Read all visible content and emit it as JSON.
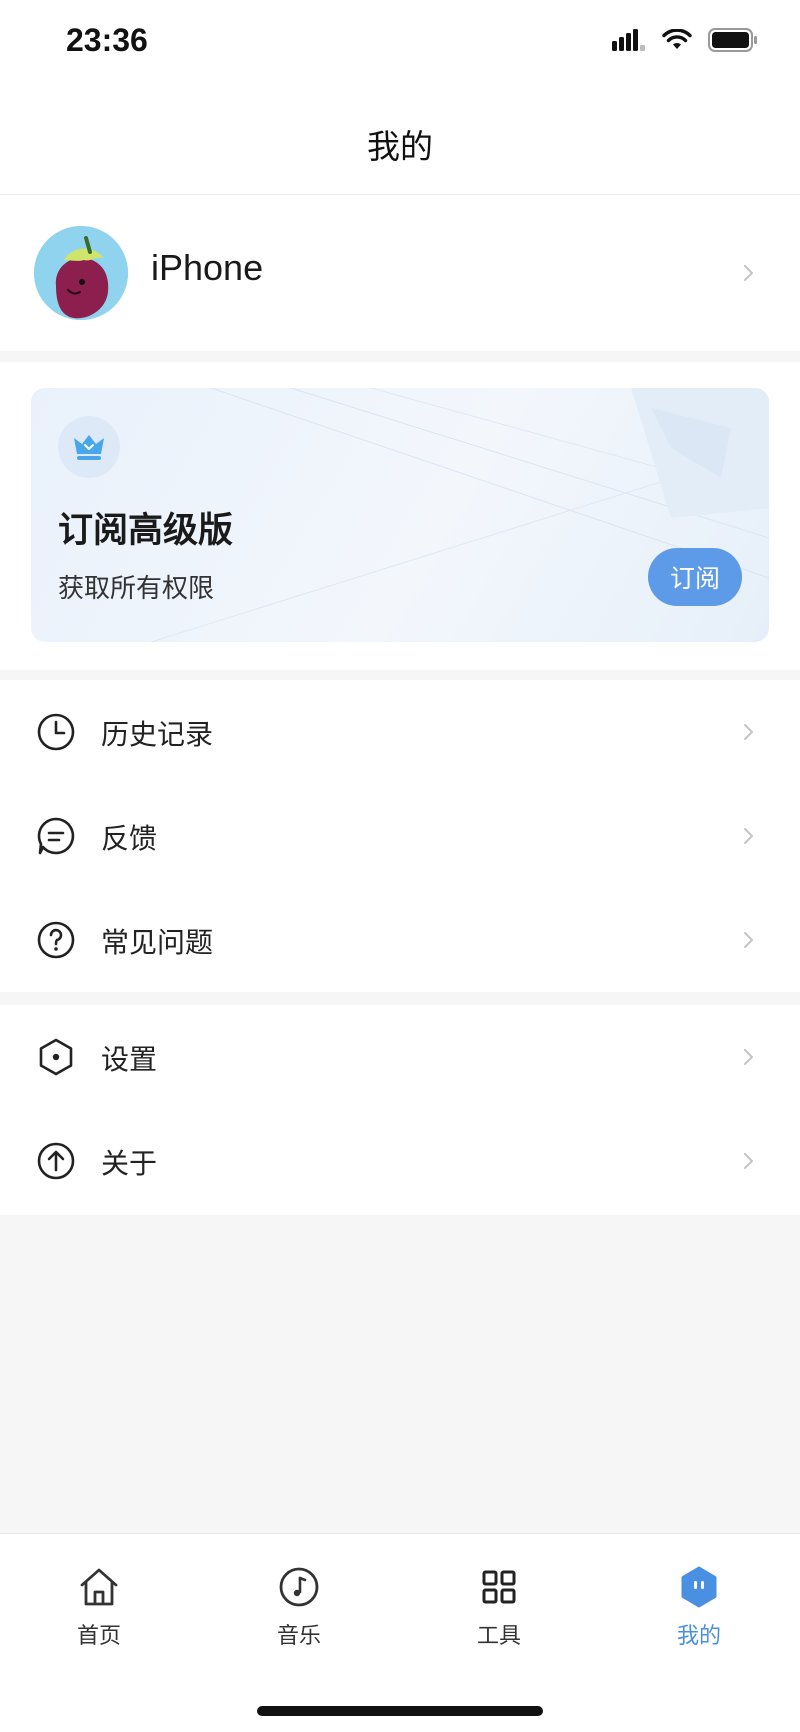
{
  "status_bar": {
    "time": "23:36",
    "icons": [
      "signal-icon",
      "wifi-icon",
      "battery-icon"
    ]
  },
  "nav": {
    "title": "我的"
  },
  "profile": {
    "name": "iPhone",
    "avatar_icon": "eggplant-avatar"
  },
  "subscription": {
    "icon": "crown-icon",
    "title": "订阅高级版",
    "description": "获取所有权限",
    "button_label": "订阅"
  },
  "menu_group_1": {
    "items": [
      {
        "icon": "clock-icon",
        "label": "历史记录"
      },
      {
        "icon": "chat-icon",
        "label": "反馈"
      },
      {
        "icon": "question-icon",
        "label": "常见问题"
      }
    ]
  },
  "menu_group_2": {
    "items": [
      {
        "icon": "settings-hexagon-icon",
        "label": "设置"
      },
      {
        "icon": "arrow-up-circle-icon",
        "label": "关于"
      }
    ]
  },
  "tab_bar": {
    "tabs": [
      {
        "icon": "home-icon",
        "label": "首页",
        "active": false
      },
      {
        "icon": "music-icon",
        "label": "音乐",
        "active": false
      },
      {
        "icon": "grid-icon",
        "label": "工具",
        "active": false
      },
      {
        "icon": "profile-icon",
        "label": "我的",
        "active": true
      }
    ]
  },
  "colors": {
    "accent": "#4a90e2",
    "button": "#5d9ae8",
    "background": "#f6f6f7"
  }
}
